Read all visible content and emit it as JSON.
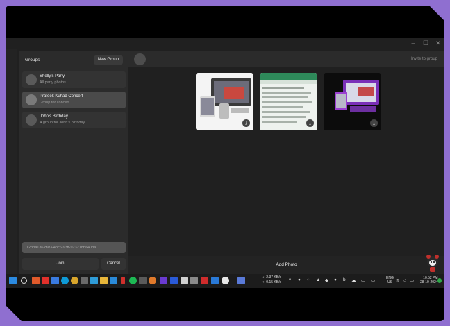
{
  "window": {
    "controls": {
      "minimize": "–",
      "maximize": "☐",
      "close": "✕"
    }
  },
  "sidebar": {
    "title": "Groups",
    "new_group_label": "New Group",
    "groups": [
      {
        "name": "Shelly's Party",
        "description": "All party photos"
      },
      {
        "name": "Prateek Kuhad Concert",
        "description": "Group for concert"
      },
      {
        "name": "John's Birthday",
        "description": "A group for John's birthday"
      }
    ],
    "code_input": {
      "value": "123ba136-d9f3-4bc6-93ff-923218ba40ba"
    },
    "join_label": "Join",
    "cancel_label": "Cancel"
  },
  "main": {
    "invite_label": "Invite to group",
    "add_photo_label": "Add Photo",
    "photos": [
      {
        "name": "photo-1",
        "download_icon": "download-icon"
      },
      {
        "name": "photo-2",
        "download_icon": "download-icon"
      },
      {
        "name": "photo-3",
        "download_icon": "download-icon"
      }
    ]
  },
  "taskbar": {
    "network": {
      "down": "↓: 2.37 KB/s",
      "up": "↑: 0.15 KB/s"
    },
    "language": {
      "line1": "ENG",
      "line2": "US"
    },
    "clock": {
      "time": "10:52 PM",
      "date": "28-10-2024"
    }
  },
  "colors": {
    "frame": "#8f6fd0",
    "background": "#202020",
    "panel": "#2b2b2b",
    "selected": "#4a4a4a"
  }
}
